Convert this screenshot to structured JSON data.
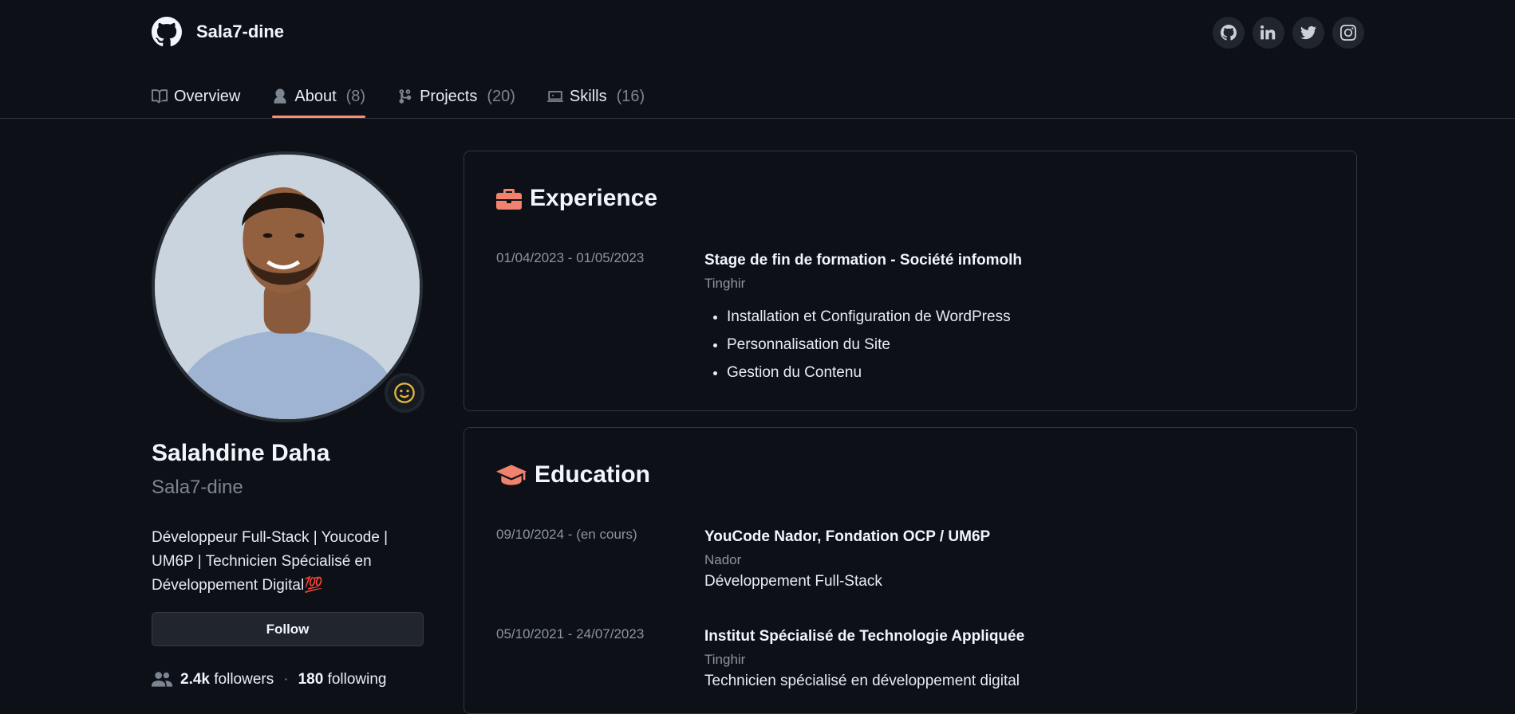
{
  "header": {
    "username": "Sala7-dine",
    "socials": [
      {
        "icon": "github-icon"
      },
      {
        "icon": "linkedin-icon"
      },
      {
        "icon": "twitter-icon"
      },
      {
        "icon": "instagram-icon"
      }
    ]
  },
  "tabs": [
    {
      "label": "Overview",
      "count": "",
      "icon": "book-icon",
      "active": false
    },
    {
      "label": "About",
      "count": "(8)",
      "icon": "person-icon",
      "active": true
    },
    {
      "label": "Projects",
      "count": "(20)",
      "icon": "branch-icon",
      "active": false
    },
    {
      "label": "Skills",
      "count": "(16)",
      "icon": "laptop-icon",
      "active": false
    }
  ],
  "profile": {
    "name": "Salahdine Daha",
    "handle": "Sala7-dine",
    "bio": "Développeur Full-Stack | Youcode | UM6P | Technicien Spécialisé en Développement Digital💯",
    "follow_label": "Follow",
    "followers_count": "2.4k",
    "followers_label": "followers",
    "following_count": "180",
    "following_label": "following",
    "status_icon": "smiley-icon"
  },
  "experience": {
    "title": "Experience",
    "items": [
      {
        "date": "01/04/2023 - 01/05/2023",
        "title": "Stage de fin de formation - Société infomolh",
        "place": "Tinghir",
        "bullets": [
          "Installation et Configuration de WordPress",
          "Personnalisation du Site",
          "Gestion du Contenu"
        ]
      }
    ]
  },
  "education": {
    "title": "Education",
    "items": [
      {
        "date": "09/10/2024 - (en cours)",
        "title": "YouCode Nador, Fondation OCP / UM6P",
        "place": "Nador",
        "desc": "Développement Full-Stack"
      },
      {
        "date": "05/10/2021 - 24/07/2023",
        "title": "Institut Spécialisé de Technologie Appliquée",
        "place": "Tinghir",
        "desc": "Technicien spécialisé en développement digital"
      }
    ]
  },
  "colors": {
    "background": "#0d1117",
    "accent": "#fd8c73",
    "section_icon": "#f0826e",
    "border": "#30363d"
  }
}
